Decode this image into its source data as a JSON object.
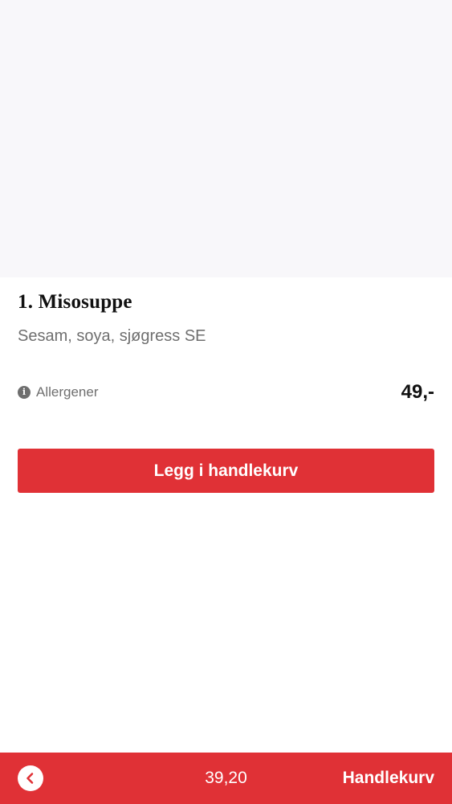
{
  "product": {
    "title": "1. Misosuppe",
    "description": "Sesam, soya, sjøgress SE",
    "allergen_label": "Allergener",
    "price": "49,-",
    "image_bg": "#f8f7fa"
  },
  "actions": {
    "add_to_cart_label": "Legg i handlekurv"
  },
  "bottom_bar": {
    "total": "39,20",
    "cart_label": "Handlekurv",
    "back_icon": "chevron-left-icon"
  },
  "colors": {
    "accent": "#e03136",
    "title_text": "#111111",
    "muted_text": "#6f6f6f"
  },
  "icons": {
    "info": "info-icon"
  }
}
